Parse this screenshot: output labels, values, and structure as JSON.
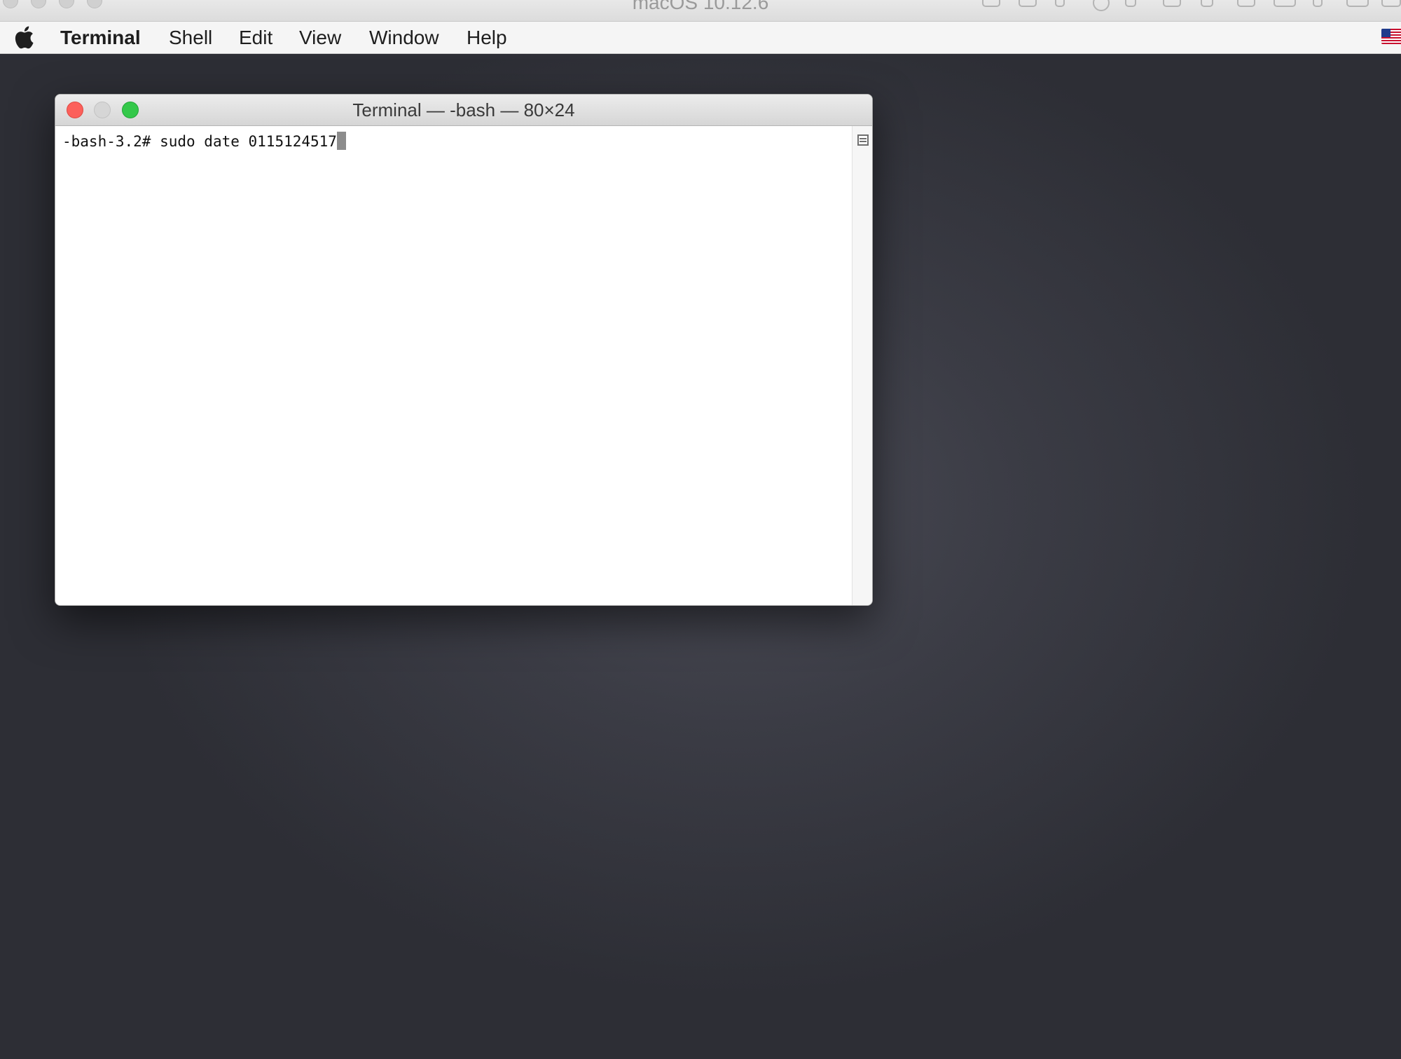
{
  "host_window": {
    "title": "macOS 10.12.6"
  },
  "menubar": {
    "apple_icon": "apple-logo-icon",
    "app_name": "Terminal",
    "items": [
      {
        "label": "Shell"
      },
      {
        "label": "Edit"
      },
      {
        "label": "View"
      },
      {
        "label": "Window"
      },
      {
        "label": "Help"
      }
    ],
    "input_source_icon": "us-flag-icon"
  },
  "terminal_window": {
    "title": "Terminal — -bash — 80×24",
    "prompt": "-bash-3.2#",
    "command": "sudo date 0115124517"
  },
  "colors": {
    "close": "#fc605b",
    "minimize": "#d6d6d6",
    "zoom": "#34c84a",
    "desktop": "#3b3c45"
  }
}
